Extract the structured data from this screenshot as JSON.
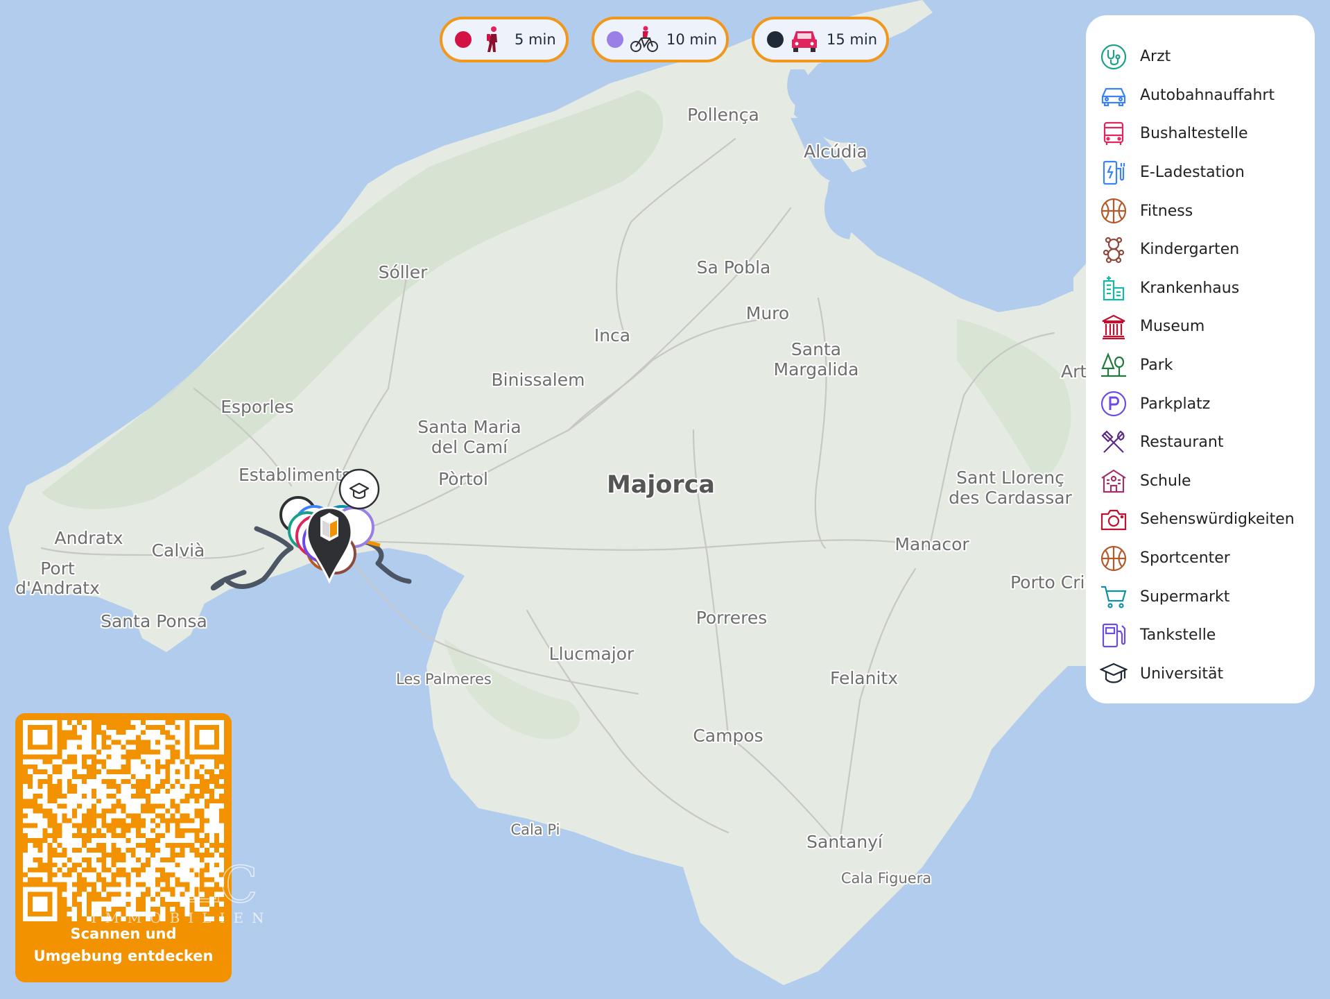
{
  "map": {
    "region_label": "Majorca",
    "places": [
      "Pollença",
      "Alcúdia",
      "Sóller",
      "Sa Pobla",
      "Muro",
      "Inca",
      "Santa",
      "Margalida",
      "Binissalem",
      "Esporles",
      "Santa Maria",
      "del Camí",
      "Establiments",
      "Pòrtol",
      "Andratx",
      "Calvià",
      "Port",
      "d'Andratx",
      "Santa Ponsa",
      "Sant Llorenç",
      "des Cardassar",
      "Manacor",
      "Porto Cristo",
      "Porreres",
      "Llucmajor",
      "Les Palmeres",
      "Felanitx",
      "Campos",
      "Cala Pi",
      "Santanyí",
      "Cala Figuera",
      "Artà"
    ],
    "colors": {
      "sea": "#b2cced",
      "land": "#e5ebe2",
      "forest": "#d3e1cf",
      "road": "#c7c7c4",
      "isochrone": "#4b5563",
      "pin": "#2f3033",
      "accent": "#f39200"
    }
  },
  "travel_modes": [
    {
      "dot_color": "#d31145",
      "icon": "walking-person-icon",
      "time": "5 min"
    },
    {
      "dot_color": "#9b7fe6",
      "icon": "bicycle-icon",
      "time": "10 min"
    },
    {
      "dot_color": "#1f2937",
      "icon": "car-icon",
      "time": "15 min"
    }
  ],
  "legend": [
    {
      "label": "Arzt",
      "icon": "stethoscope-icon",
      "color": "#1a9f8a"
    },
    {
      "label": "Autobahnauffahrt",
      "icon": "car-icon",
      "color": "#3b82f6"
    },
    {
      "label": "Bushaltestelle",
      "icon": "bus-icon",
      "color": "#e0245e"
    },
    {
      "label": "E-Ladestation",
      "icon": "charging-station-icon",
      "color": "#3b82f6"
    },
    {
      "label": "Fitness",
      "icon": "basketball-icon",
      "color": "#b35a2b"
    },
    {
      "label": "Kindergarten",
      "icon": "teddy-bear-icon",
      "color": "#8b4a3c"
    },
    {
      "label": "Krankenhaus",
      "icon": "hospital-icon",
      "color": "#14b8a6"
    },
    {
      "label": "Museum",
      "icon": "museum-icon",
      "color": "#c01030"
    },
    {
      "label": "Park",
      "icon": "trees-icon",
      "color": "#1f7a3a"
    },
    {
      "label": "Parkplatz",
      "icon": "parking-icon",
      "color": "#6d4ae6"
    },
    {
      "label": "Restaurant",
      "icon": "cutlery-icon",
      "color": "#5b2c83"
    },
    {
      "label": "Schule",
      "icon": "school-icon",
      "color": "#a0306a"
    },
    {
      "label": "Sehenswürdigkeiten",
      "icon": "camera-icon",
      "color": "#c01030"
    },
    {
      "label": "Sportcenter",
      "icon": "basketball-icon",
      "color": "#b35a2b"
    },
    {
      "label": "Supermarkt",
      "icon": "shopping-cart-icon",
      "color": "#0e8fa8"
    },
    {
      "label": "Tankstelle",
      "icon": "fuel-pump-icon",
      "color": "#6d4ae6"
    },
    {
      "label": "Universität",
      "icon": "graduation-cap-icon",
      "color": "#1f2937"
    }
  ],
  "qr": {
    "caption_line1": "Scannen und",
    "caption_line2": "Umgebung entdecken"
  },
  "watermark": {
    "brand": "LC",
    "tagline": "IMMOBILIEN"
  }
}
